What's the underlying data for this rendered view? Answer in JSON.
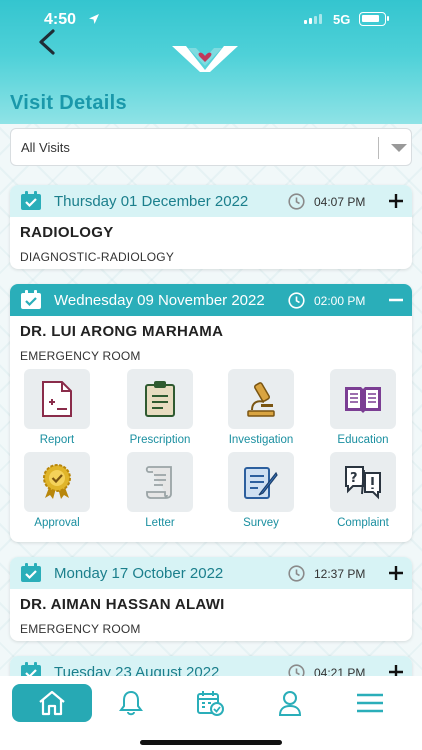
{
  "status_bar": {
    "time": "4:50",
    "network": "5G"
  },
  "header": {
    "title": "Visit Details"
  },
  "filter": {
    "selected": "All Visits"
  },
  "visits": [
    {
      "date": "Thursday 01 December 2022",
      "time": "04:07 PM",
      "doctor": "RADIOLOGY",
      "department": "DIAGNOSTIC-RADIOLOGY",
      "expanded": false
    },
    {
      "date": "Wednesday 09 November 2022",
      "time": "02:00 PM",
      "doctor": "DR. LUI ARONG MARHAMA",
      "department": "EMERGENCY ROOM",
      "expanded": true
    },
    {
      "date": "Monday 17 October 2022",
      "time": "12:37 PM",
      "doctor": "DR. AIMAN HASSAN ALAWI",
      "department": "EMERGENCY ROOM",
      "expanded": false
    },
    {
      "date": "Tuesday 23 August 2022",
      "time": "04:21 PM",
      "expanded": false
    }
  ],
  "actions": [
    {
      "label": "Report",
      "icon": "report-icon"
    },
    {
      "label": "Prescription",
      "icon": "prescription-icon"
    },
    {
      "label": "Investigation",
      "icon": "microscope-icon"
    },
    {
      "label": "Education",
      "icon": "book-icon"
    },
    {
      "label": "Approval",
      "icon": "approval-badge-icon"
    },
    {
      "label": "Letter",
      "icon": "scroll-letter-icon"
    },
    {
      "label": "Survey",
      "icon": "survey-icon"
    },
    {
      "label": "Complaint",
      "icon": "complaint-icon"
    }
  ],
  "tabbar": [
    {
      "icon": "home-icon",
      "active": true
    },
    {
      "icon": "bell-icon",
      "active": false
    },
    {
      "icon": "calendar-check-icon",
      "active": false
    },
    {
      "icon": "user-icon",
      "active": false
    },
    {
      "icon": "menu-icon",
      "active": false
    }
  ],
  "colors": {
    "primary": "#2aaeb9",
    "accent_text": "#1a98aa",
    "header_light": "#d7f3f5"
  }
}
